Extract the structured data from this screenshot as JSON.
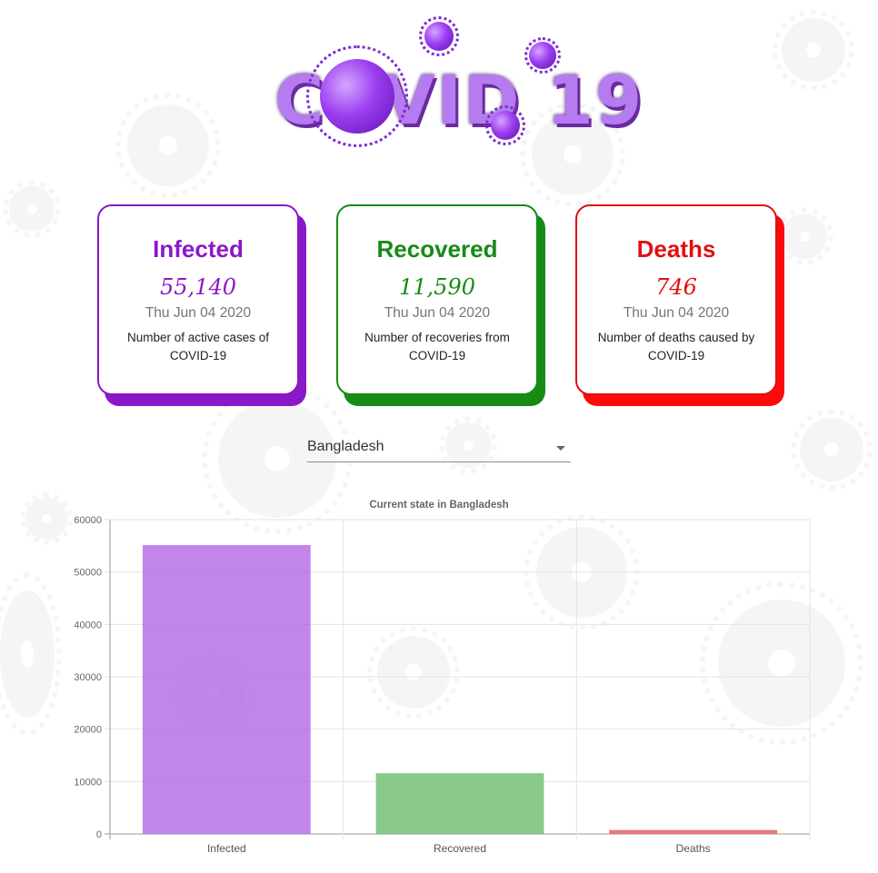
{
  "header": {
    "logo_text": "COVID 19"
  },
  "cards": [
    {
      "key": "infected",
      "title": "Infected",
      "value": "55,140",
      "date": "Thu Jun 04 2020",
      "description": "Number of active cases of COVID-19",
      "color": "#8a18c8",
      "shadow_color": "#8a18c8"
    },
    {
      "key": "recovered",
      "title": "Recovered",
      "value": "11,590",
      "date": "Thu Jun 04 2020",
      "description": "Number of recoveries from COVID-19",
      "color": "#168b16",
      "shadow_color": "#168b16"
    },
    {
      "key": "deaths",
      "title": "Deaths",
      "value": "746",
      "date": "Thu Jun 04 2020",
      "description": "Number of deaths caused by COVID-19",
      "color": "#e01010",
      "shadow_color": "#ff0a0a"
    }
  ],
  "country_select": {
    "selected": "Bangladesh"
  },
  "chart_data": {
    "type": "bar",
    "title": "Current state in Bangladesh",
    "categories": [
      "Infected",
      "Recovered",
      "Deaths"
    ],
    "values": [
      55140,
      11590,
      746
    ],
    "bar_colors": [
      "#b56be6",
      "#6fbd6f",
      "#e55a5a"
    ],
    "ylim": [
      0,
      60000
    ],
    "yticks": [
      0,
      10000,
      20000,
      30000,
      40000,
      50000,
      60000
    ],
    "grid": true,
    "legend": "none"
  }
}
